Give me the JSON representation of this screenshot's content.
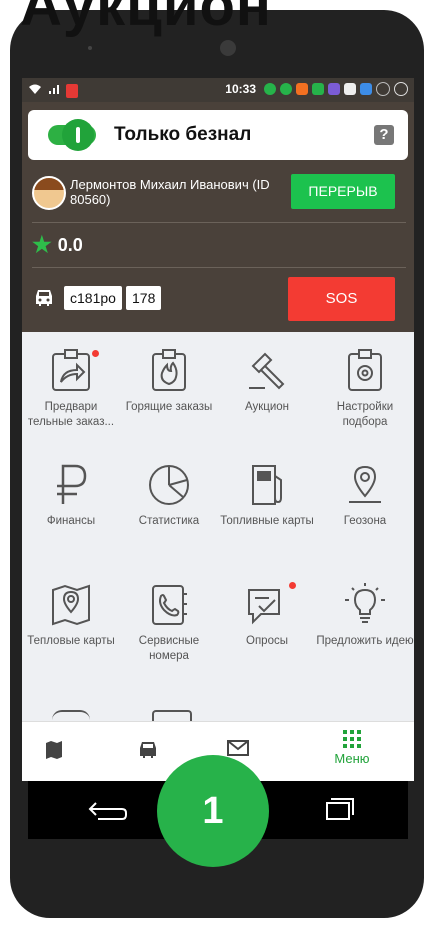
{
  "page_heading": "Аукцион",
  "status_bar": {
    "time": "10:33"
  },
  "payment_toggle": {
    "label": "Только безнал",
    "state": "on",
    "help_label": "?"
  },
  "driver": {
    "name": "Лермонтов Михаил Иванович (ID 80560)",
    "break_button": "ПЕРЕРЫВ"
  },
  "rating": {
    "value": "0.0"
  },
  "car": {
    "plate": "с181ро",
    "number": "178",
    "sos_button": "SOS"
  },
  "menu_tiles": [
    {
      "label": "Предвари тельные заказ...",
      "icon": "share-icon"
    },
    {
      "label": "Горящие заказы",
      "icon": "fire-icon"
    },
    {
      "label": "Аукцион",
      "icon": "gavel-icon"
    },
    {
      "label": "Настройки подбора",
      "icon": "gear-icon"
    },
    {
      "label": "Финансы",
      "icon": "ruble-icon"
    },
    {
      "label": "Статистика",
      "icon": "pie-chart-icon"
    },
    {
      "label": "Топливные карты",
      "icon": "fuel-icon"
    },
    {
      "label": "Геозона",
      "icon": "location-pin-icon"
    },
    {
      "label": "Тепловые карты",
      "icon": "map-pin-icon"
    },
    {
      "label": "Сервисные номера",
      "icon": "phone-book-icon"
    },
    {
      "label": "Опросы",
      "icon": "chat-check-icon"
    },
    {
      "label": "Предложить идею",
      "icon": "lightbulb-icon"
    }
  ],
  "bottom_nav": {
    "menu_label": "Меню"
  },
  "step_badge": "1",
  "colors": {
    "accent": "#21a33a",
    "sos": "#f33b33",
    "dark": "#4a413a"
  }
}
